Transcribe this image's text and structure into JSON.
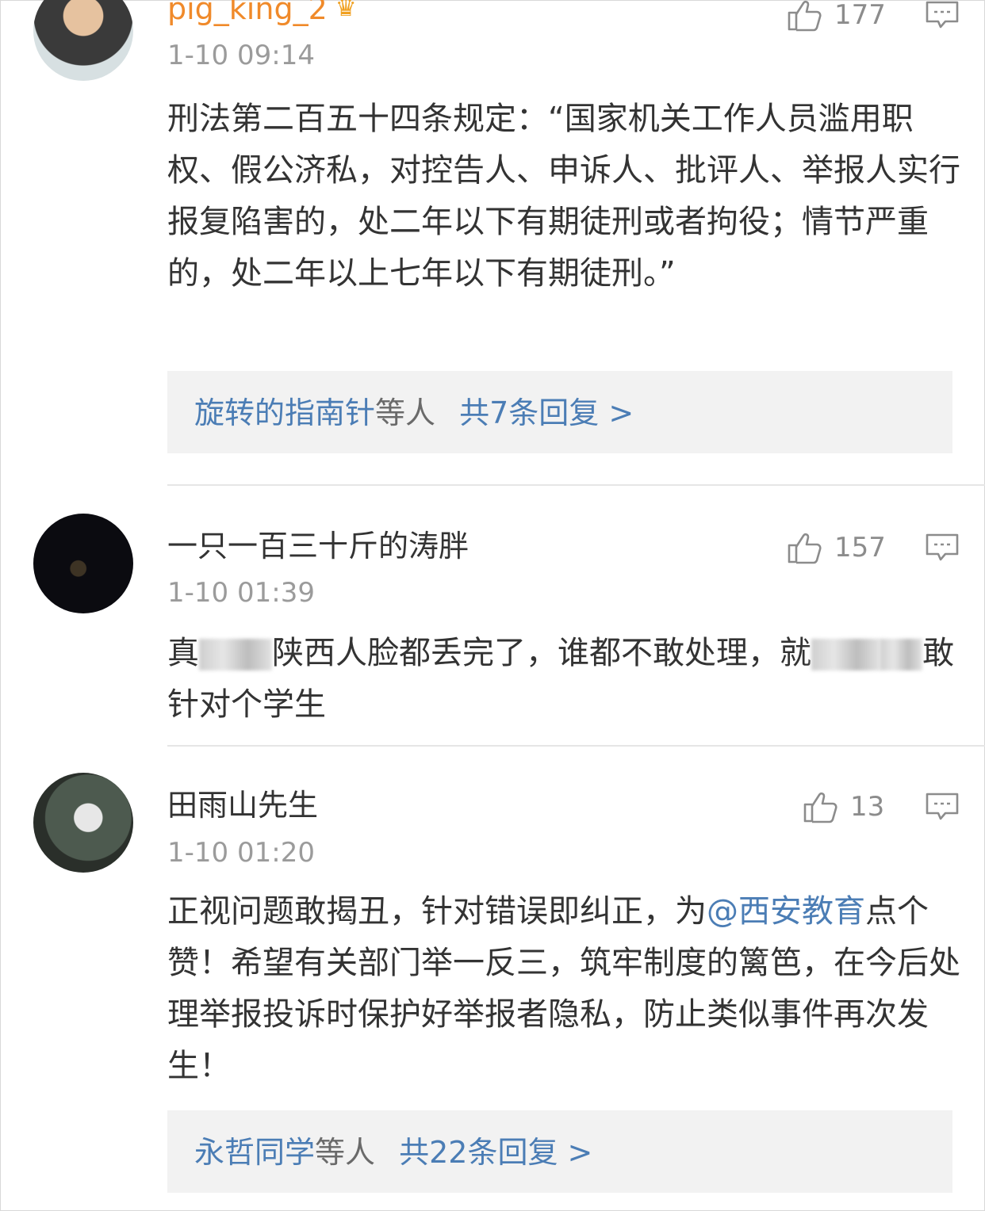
{
  "comments": [
    {
      "username": "pig_king_2",
      "timestamp": "1-10 09:14",
      "likes": "177",
      "badge_icon": "crown-badge-icon",
      "text": "刑法第二百五十四条规定：“国家机关工作人员滥用职权、假公济私，对控告人、申诉人、批评人、举报人实行报复陷害的，处二年以下有期徒刑或者拘役；情节严重的，处二年以上七年以下有期徒刑。”",
      "reply_summary": {
        "names": "旋转的指南针",
        "suffix": "等人",
        "count": "共7条回复 >"
      }
    },
    {
      "username": "一只一百三十斤的涛胖",
      "timestamp": "1-10 01:39",
      "likes": "157",
      "text_part1": "真",
      "text_part2": "陕西人脸都丢完了，谁都不敢处理，就",
      "text_part3": "敢针对个学生"
    },
    {
      "username": "田雨山先生",
      "timestamp": "1-10 01:20",
      "likes": "13",
      "text_part1": "正视问题敢揭丑，针对错误即纠正，为",
      "mention": "@西安教育",
      "text_part2": "点个赞！希望有关部门举一反三，筑牢制度的篱笆，在今后处理举报投诉时保护好举报者隐私，防止类似事件再次发生！",
      "reply_summary": {
        "names": "永哲同学",
        "suffix": "等人",
        "count": "共22条回复 >"
      }
    }
  ],
  "colors": {
    "link": "#4b7db5",
    "username_vip": "#f08a2a",
    "timestamp": "#9b9b9b",
    "reply_box_bg": "#f2f2f2"
  }
}
